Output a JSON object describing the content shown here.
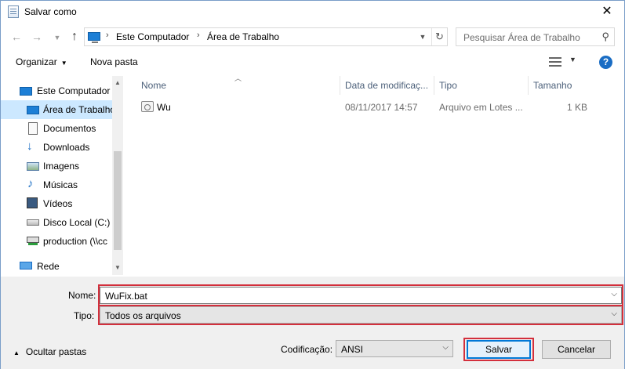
{
  "window": {
    "title": "Salvar como"
  },
  "nav": {
    "address": [
      "Este Computador",
      "Área de Trabalho"
    ],
    "search_placeholder": "Pesquisar Área de Trabalho"
  },
  "commands": {
    "organize": "Organizar",
    "new_folder": "Nova pasta"
  },
  "sidebar": {
    "items": [
      {
        "label": "Este Computador",
        "icon": "computer-icon"
      },
      {
        "label": "Área de Trabalho",
        "icon": "desktop-icon",
        "selected": true
      },
      {
        "label": "Documentos",
        "icon": "documents-icon"
      },
      {
        "label": "Downloads",
        "icon": "downloads-icon"
      },
      {
        "label": "Imagens",
        "icon": "pictures-icon"
      },
      {
        "label": "Músicas",
        "icon": "music-icon"
      },
      {
        "label": "Vídeos",
        "icon": "videos-icon"
      },
      {
        "label": "Disco Local (C:)",
        "icon": "disk-icon"
      },
      {
        "label": "production (\\\\cc",
        "icon": "network-drive-icon"
      },
      {
        "label": "Rede",
        "icon": "network-icon"
      }
    ]
  },
  "table": {
    "columns": [
      "Nome",
      "Data de modificaç...",
      "Tipo",
      "Tamanho"
    ],
    "rows": [
      {
        "name": "Wu",
        "modified": "08/11/2017 14:57",
        "type": "Arquivo em Lotes ...",
        "size": "1 KB"
      }
    ]
  },
  "form": {
    "name_label": "Nome:",
    "name_value": "WuFix.bat",
    "type_label": "Tipo:",
    "type_value": "Todos os arquivos",
    "encoding_label": "Codificação:",
    "encoding_value": "ANSI",
    "hide_folders": "Ocultar pastas",
    "save": "Salvar",
    "cancel": "Cancelar"
  },
  "colors": {
    "accent": "#0078d7",
    "highlight_border": "#d32f3c",
    "selection": "#cce8ff"
  }
}
